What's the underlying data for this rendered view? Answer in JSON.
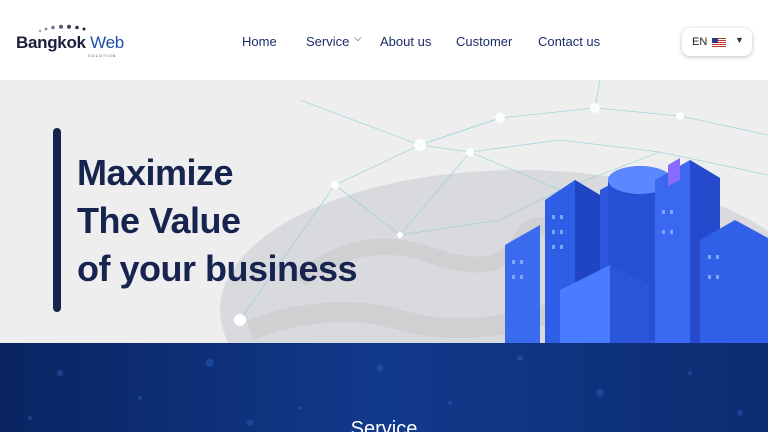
{
  "header": {
    "logo": {
      "primary": "Bangkok",
      "secondary": "Web",
      "tagline": "SOLUTION"
    },
    "nav": {
      "home": "Home",
      "service": "Service",
      "about": "About us",
      "customer": "Customer",
      "contact": "Contact us"
    },
    "language": {
      "code": "EN",
      "flag_icon": "us-flag-icon"
    }
  },
  "hero": {
    "line1": "Maximize",
    "line2": "The Value",
    "line3": "of your business"
  },
  "service_section": {
    "title": "Service"
  },
  "colors": {
    "navy": "#17244f",
    "nav_text": "#1a2d6b",
    "accent_blue": "#1f4fa8",
    "service_bg": "#0b2a6b"
  }
}
